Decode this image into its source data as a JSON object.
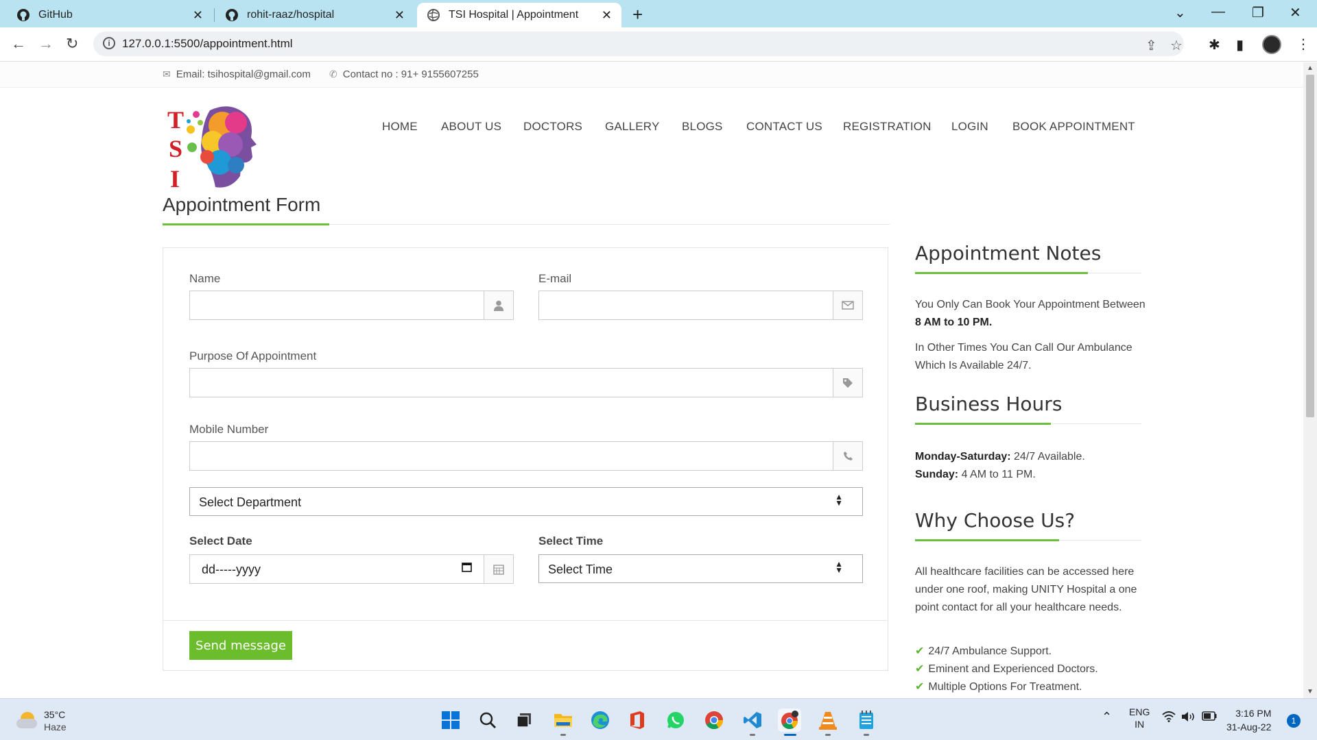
{
  "browser": {
    "tabs": [
      {
        "label": "GitHub",
        "icon": "github-icon"
      },
      {
        "label": "rohit-raaz/hospital",
        "icon": "github-icon"
      },
      {
        "label": "TSI Hospital | Appointment",
        "icon": "globe-icon",
        "active": true
      }
    ],
    "url": "127.0.0.1:5500/appointment.html"
  },
  "topbar": {
    "email": "Email: tsihospital@gmail.com",
    "contact": "Contact no : 91+ 9155607255"
  },
  "logo": {
    "letters": [
      "T",
      "S",
      "I"
    ]
  },
  "nav": [
    "HOME",
    "ABOUT US",
    "DOCTORS",
    "GALLERY",
    "BLOGS",
    "CONTACT US",
    "REGISTRATION",
    "LOGIN",
    "BOOK APPOINTMENT"
  ],
  "form": {
    "title": "Appointment Form",
    "name_label": "Name",
    "email_label": "E-mail",
    "purpose_label": "Purpose Of Appointment",
    "mobile_label": "Mobile Number",
    "department_select": "Select Department",
    "date_label": "Select Date",
    "date_value": "dd-----yyyy",
    "time_label": "Select Time",
    "time_select": "Select Time",
    "submit": "Send message"
  },
  "sidebar": {
    "notes_title": "Appointment Notes",
    "notes_p1_a": "You Only Can Book Your Appointment Between ",
    "notes_p1_b": "8 AM to 10 PM.",
    "notes_p2": "In Other Times You Can Call Our Ambulance Which Is Available 24/7.",
    "hours_title": "Business Hours",
    "hours": [
      {
        "day": "Monday-Saturday:",
        "value": " 24/7 Available."
      },
      {
        "day": "Sunday:",
        "value": " 4 AM to 11 PM."
      }
    ],
    "why_title": "Why Choose Us?",
    "why_text": "All healthcare facilities can be accessed here under one roof, making UNITY Hospital a one point contact for all your healthcare needs.",
    "why_points": [
      "24/7 Ambulance Support.",
      "Eminent and Experienced Doctors.",
      "Multiple Options For Treatment."
    ]
  },
  "taskbar": {
    "temp": "35°C",
    "weather": "Haze",
    "lang": "ENG",
    "region": "IN",
    "time": "3:16 PM",
    "date": "31-Aug-22",
    "notifications": "1"
  },
  "colors": {
    "accent": "#6bbd2c",
    "tabbar": "#b9e3f0"
  }
}
